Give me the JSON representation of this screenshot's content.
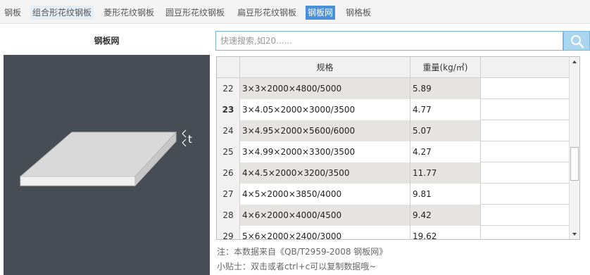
{
  "tabs": [
    {
      "label": "钢板",
      "style": "plain"
    },
    {
      "label": "组合形花纹钢板",
      "style": "light"
    },
    {
      "label": "菱形花纹钢板",
      "style": "plain"
    },
    {
      "label": "圆豆形花纹钢板",
      "style": "plain"
    },
    {
      "label": "扁豆形花纹钢板",
      "style": "plain"
    },
    {
      "label": "钢板网",
      "style": "active"
    },
    {
      "label": "钢格板",
      "style": "plain"
    }
  ],
  "left_panel": {
    "title": "钢板网",
    "dimension_label": "t"
  },
  "search": {
    "placeholder": "快速搜索,如20......",
    "value": "",
    "button_icon": "search-icon"
  },
  "table": {
    "columns": [
      "规格",
      "重量(kg/㎡)"
    ],
    "rows": [
      {
        "num": "22",
        "spec": "3×3×2000×4800/5000",
        "weight": "5.89",
        "current": false
      },
      {
        "num": "23",
        "spec": "3×4.05×2000×3000/3500",
        "weight": "4.77",
        "current": true
      },
      {
        "num": "24",
        "spec": "3×4.95×2000×5600/6000",
        "weight": "5.07",
        "current": false
      },
      {
        "num": "25",
        "spec": "3×4.99×2000×3300/3500",
        "weight": "4.27",
        "current": false
      },
      {
        "num": "26",
        "spec": "4×4.5×2000×3200/3500",
        "weight": "11.77",
        "current": false
      },
      {
        "num": "27",
        "spec": "4×5×2000×3850/4000",
        "weight": "9.81",
        "current": false
      },
      {
        "num": "28",
        "spec": "4×6×2000×4000/4500",
        "weight": "9.42",
        "current": false
      },
      {
        "num": "29",
        "spec": "5×6×2000×2400/3000",
        "weight": "19.62",
        "current": false
      }
    ]
  },
  "notes": {
    "source": "注：本数据来自《QB/T2959-2008  钢板网》",
    "tip": "小贴士：双击或者ctrl+c可以复制数据哦~"
  },
  "colors": {
    "accent": "#4a90d9",
    "illustration_bg": "#474d55",
    "row_shade": "#e6e4e0"
  }
}
